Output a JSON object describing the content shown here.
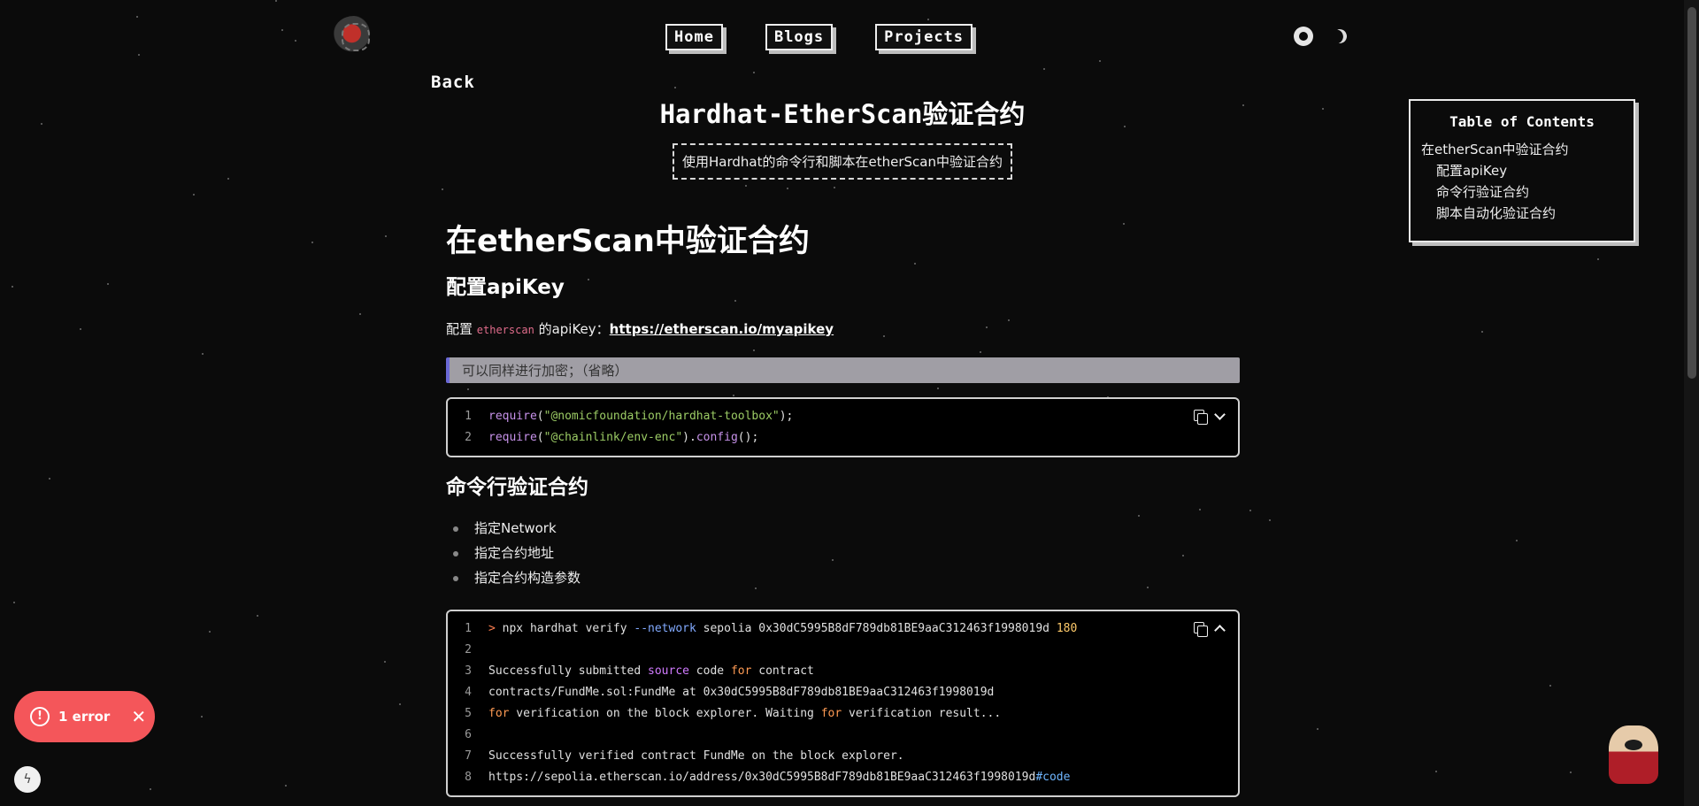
{
  "header": {
    "nav": [
      "Home",
      "Blogs",
      "Projects"
    ]
  },
  "back_label": "Back",
  "title": "Hardhat-EtherScan验证合约",
  "subtitle": "使用Hardhat的命令行和脚本在etherScan中验证合约",
  "toc": {
    "title": "Table of Contents",
    "items": [
      "在etherScan中验证合约",
      "配置apiKey",
      "命令行验证合约",
      "脚本自动化验证合约"
    ]
  },
  "article": {
    "h1": "在etherScan中验证合约",
    "section1_title": "配置apiKey",
    "para_prefix": "配置 ",
    "para_code": "etherscan",
    "para_middle": " 的apiKey：",
    "para_link": "https://etherscan.io/myapikey",
    "quote": "可以同样进行加密；（省略）",
    "code1_lines": [
      "1",
      "2"
    ],
    "section2_title": "命令行验证合约",
    "bullets": [
      "指定Network",
      "指定合约地址",
      "指定合约构造参数"
    ],
    "code2_lines": [
      "1",
      "2",
      "3",
      "4",
      "5",
      "6",
      "7",
      "8"
    ]
  },
  "error_toast": {
    "label": "1 error",
    "icon": "!"
  },
  "icons": [
    "github-icon",
    "moon-icon",
    "copy-icon",
    "chevron-down-icon",
    "chevron-up-icon",
    "error-icon",
    "close-icon",
    "bolt-icon"
  ]
}
